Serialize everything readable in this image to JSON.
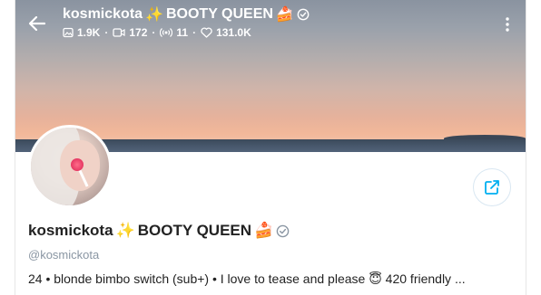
{
  "header": {
    "username": "kosmickota",
    "title_suffix": "BOOTY QUEEN",
    "sparkle_emoji": "✨",
    "cake_emoji": "🍰",
    "stats": {
      "photos": "1.9K",
      "videos": "172",
      "streams": "11",
      "likes": "131.0K"
    },
    "separator": "·"
  },
  "profile": {
    "display_name": "kosmickota",
    "name_suffix": "BOOTY QUEEN",
    "handle": "@kosmickota",
    "bio": "24 • blonde bimbo switch (sub+) • I love to tease and please 😇 420 friendly ..."
  },
  "colors": {
    "accent": "#00aff0",
    "verified": "#8a96a3"
  },
  "icons": {
    "back": "arrow-left-icon",
    "menu": "more-vertical-icon",
    "share": "share-icon",
    "photo": "image-icon",
    "video": "video-icon",
    "stream": "broadcast-icon",
    "likes": "heart-icon",
    "verified": "verified-icon"
  }
}
